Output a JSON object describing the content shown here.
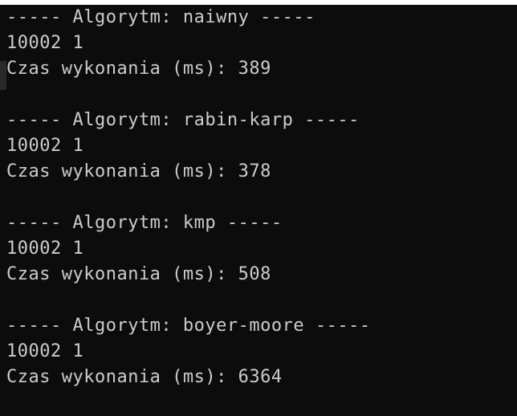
{
  "console": {
    "lines": [
      "----- Algorytm: naiwny -----",
      "10002 1",
      "Czas wykonania (ms): 389",
      "",
      "----- Algorytm: rabin-karp -----",
      "10002 1",
      "Czas wykonania (ms): 378",
      "",
      "----- Algorytm: kmp -----",
      "10002 1",
      "Czas wykonania (ms): 508",
      "",
      "----- Algorytm: boyer-moore -----",
      "10002 1",
      "Czas wykonania (ms): 6364"
    ]
  },
  "colors": {
    "background": "#0c0c0c",
    "text": "#cccccc",
    "top_strip": "#ffffff"
  }
}
